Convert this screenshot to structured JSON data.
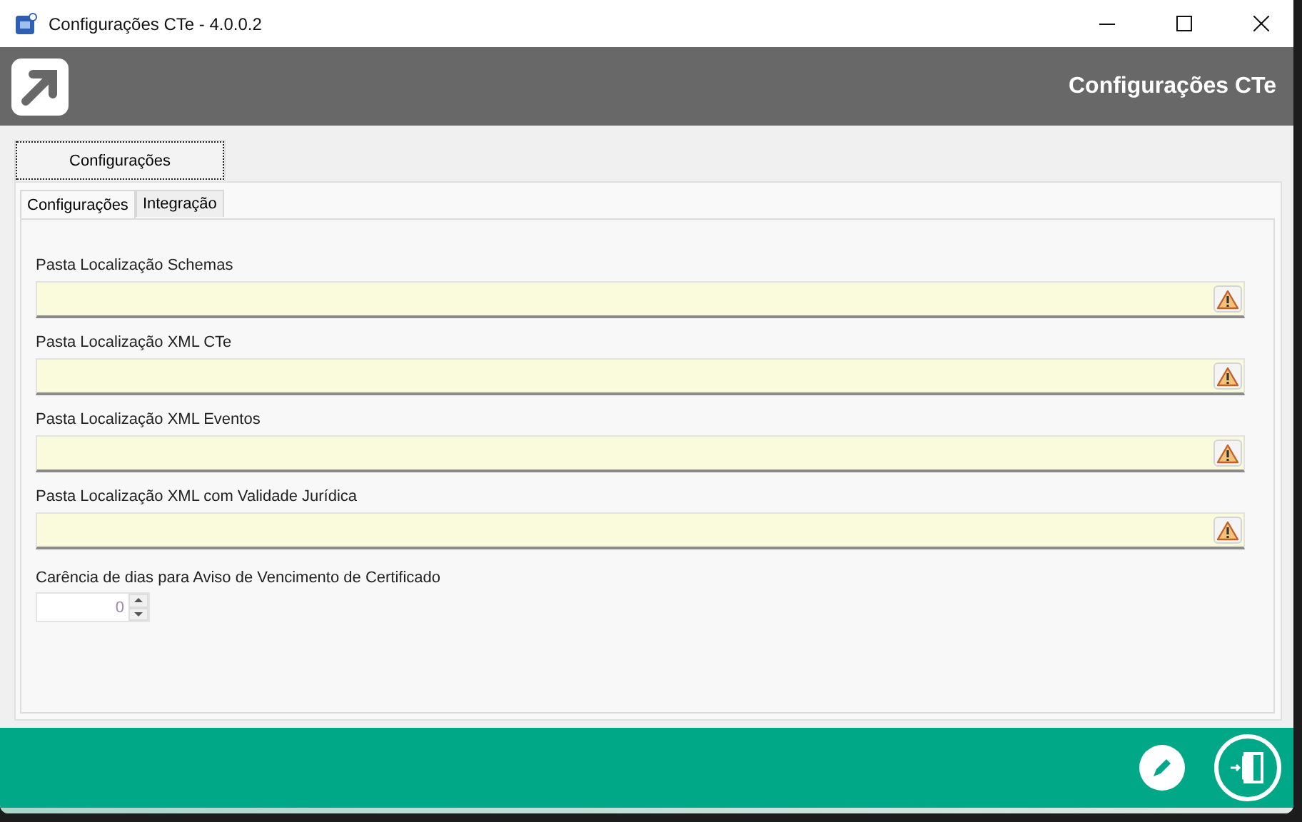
{
  "window": {
    "title": "Configurações CTe - 4.0.0.2"
  },
  "header": {
    "title": "Configurações CTe"
  },
  "outer_tabs": [
    {
      "label": "Configurações",
      "selected": true
    }
  ],
  "inner_tabs": [
    {
      "label": "Configurações",
      "selected": true
    },
    {
      "label": "Integração",
      "selected": false
    }
  ],
  "fields": [
    {
      "label": "Pasta Localização Schemas",
      "warning": true
    },
    {
      "label": "Pasta Localização XML CTe",
      "warning": true
    },
    {
      "label": "Pasta Localização XML Eventos",
      "warning": true
    },
    {
      "label": "Pasta Localização XML com Validade Jurídica",
      "warning": true
    }
  ],
  "spinner": {
    "label": "Carência de dias para Aviso de Vencimento de Certificado",
    "value": "0"
  }
}
